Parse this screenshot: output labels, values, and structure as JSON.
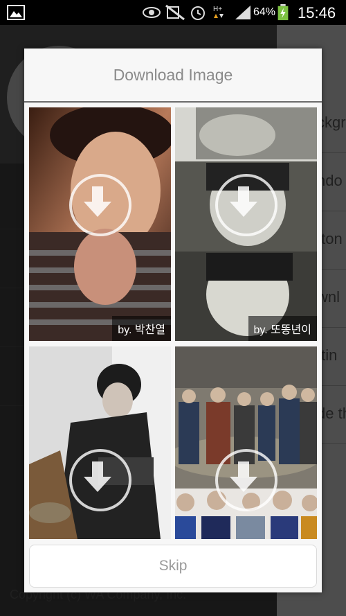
{
  "status_bar": {
    "battery_percent": "64%",
    "time": "15:46",
    "icons": [
      "gallery-icon",
      "eye-icon",
      "mute-icon",
      "alarm-icon",
      "data-icon",
      "signal-icon",
      "battery-icon"
    ]
  },
  "background_app": {
    "menu_items": [
      "ckgr",
      "ndo",
      "tton",
      "wnl",
      "ttin",
      "de th"
    ],
    "footer": "Copyright (c) WA Company, Inc."
  },
  "dialog": {
    "title": "Download Image",
    "thumbnails": [
      {
        "author": "by. 박찬열",
        "icon": "download-icon"
      },
      {
        "author": "by. 또똥년이",
        "icon": "download-icon"
      },
      {
        "author": "",
        "icon": "download-icon"
      },
      {
        "author": "",
        "icon": "download-icon"
      }
    ],
    "skip_label": "Skip"
  },
  "colors": {
    "dialog_bg": "#f7f7f7",
    "status_bar_bg": "#000000",
    "text_gray": "#8a8a8a",
    "battery_green": "#7cc142"
  }
}
